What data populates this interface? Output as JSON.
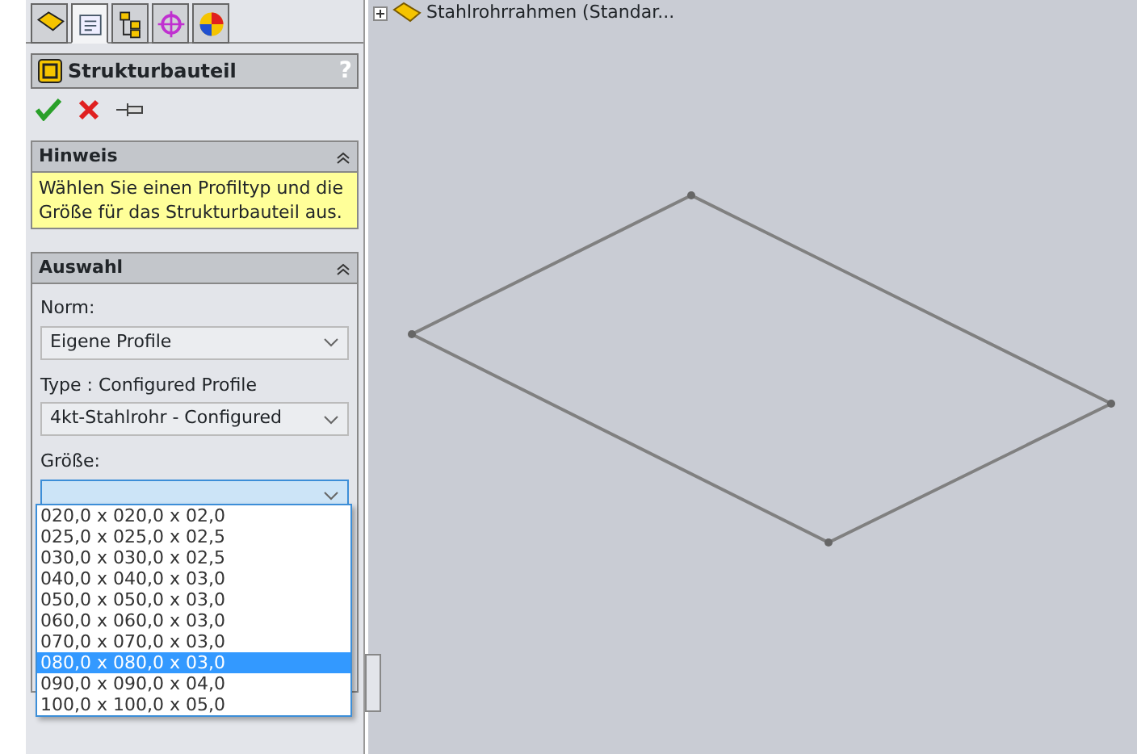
{
  "tabs": [
    {
      "kind": "part",
      "selected": false
    },
    {
      "kind": "properties",
      "selected": true
    },
    {
      "kind": "config",
      "selected": false
    },
    {
      "kind": "target",
      "selected": false
    },
    {
      "kind": "display",
      "selected": false
    }
  ],
  "property_manager": {
    "title": "Strukturbauteil",
    "help": "?"
  },
  "hint": {
    "title": "Hinweis",
    "text": "Wählen Sie einen Profiltyp und die Größe für das Strukturbauteil aus."
  },
  "selection": {
    "title": "Auswahl",
    "fields": [
      {
        "label": "Norm:",
        "value": "Eigene Profile",
        "open": false
      },
      {
        "label": "Type : Configured Profile",
        "value": "4kt-Stahlrohr - Configured",
        "open": false
      },
      {
        "label": "Größe:",
        "open": true
      }
    ]
  },
  "size_options": [
    {
      "label": "020,0 x 020,0 x 02,0",
      "selected": false
    },
    {
      "label": "025,0 x 025,0 x 02,5",
      "selected": false
    },
    {
      "label": "030,0 x 030,0 x 02,5",
      "selected": false
    },
    {
      "label": "040,0 x 040,0 x 03,0",
      "selected": false
    },
    {
      "label": "050,0 x 050,0 x 03,0",
      "selected": false
    },
    {
      "label": "060,0 x 060,0 x 03,0",
      "selected": false
    },
    {
      "label": "070,0 x 070,0 x 03,0",
      "selected": false
    },
    {
      "label": "080,0 x 080,0 x 03,0",
      "selected": true
    },
    {
      "label": "090,0 x 090,0 x 04,0",
      "selected": false
    },
    {
      "label": "100,0 x 100,0 x 05,0",
      "selected": false
    }
  ],
  "tree": {
    "item": "Stahlrohrrahmen  (Standar..."
  }
}
